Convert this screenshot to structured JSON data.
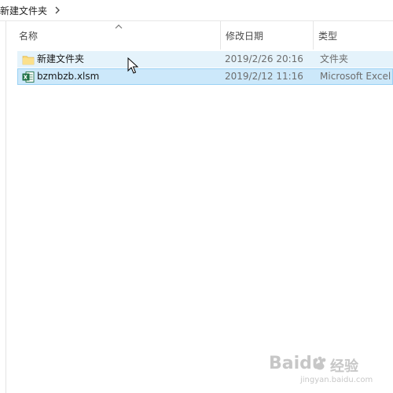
{
  "breadcrumb": {
    "current": "新建文件夹"
  },
  "columns": {
    "name": "名称",
    "date": "修改日期",
    "type": "类型"
  },
  "files": [
    {
      "name": "新建文件夹",
      "date": "2019/2/26 20:16",
      "type": "文件夹",
      "icon": "folder-icon",
      "state": "hover"
    },
    {
      "name": "bzmbzb.xlsm",
      "date": "2019/2/12 11:16",
      "type": "Microsoft Excel",
      "icon": "excel-file-icon",
      "state": "selected"
    }
  ],
  "watermark": {
    "brand": "Baidu",
    "brand_cn": "经验",
    "url": "jingyan.baidu.com"
  },
  "colors": {
    "hover": "#e5f3fb",
    "selected": "#cce8fa",
    "selected_border": "#99d1f4",
    "folder": "#f8d775",
    "excel": "#1e7145"
  }
}
